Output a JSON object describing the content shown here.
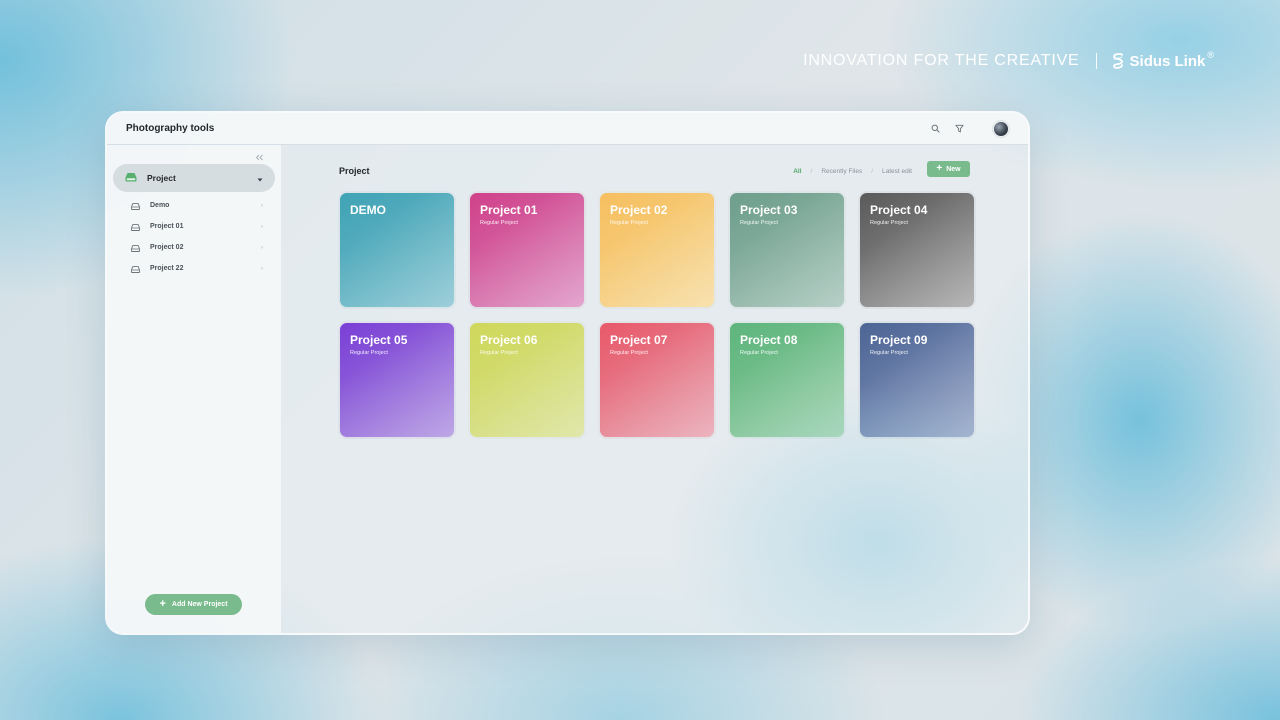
{
  "brand": {
    "tagline": "INNOVATION FOR THE CREATIVE",
    "name": "Sidus Link",
    "registered_mark": "®"
  },
  "window": {
    "title": "Photography tools",
    "icons": [
      "search-icon",
      "filter-icon",
      "avatar"
    ]
  },
  "sidebar": {
    "section_label": "Project",
    "items": [
      {
        "label": "Demo",
        "icon": "drive-icon"
      },
      {
        "label": "Project 01",
        "icon": "drive-icon"
      },
      {
        "label": "Project 02",
        "icon": "drive-icon"
      },
      {
        "label": "Project 22",
        "icon": "drive-icon"
      }
    ],
    "add_button": {
      "plus": "+",
      "label": "Add New Project"
    }
  },
  "main": {
    "title": "Project",
    "filters": {
      "all": "All",
      "recent": "Recently Files",
      "latest": "Latest edit",
      "separator": "/"
    },
    "new_button": {
      "plus": "+",
      "label": "New"
    }
  },
  "cards": [
    {
      "title": "DEMO",
      "subtitle": "",
      "color_from": "#3fa3b5",
      "color_to": "#77bccb"
    },
    {
      "title": "Project 01",
      "subtitle": "Regular Project",
      "color_from": "#d0418a",
      "color_to": "#d883bb"
    },
    {
      "title": "Project 02",
      "subtitle": "Regular Project",
      "color_from": "#f6bf5f",
      "color_to": "#f5d690"
    },
    {
      "title": "Project 03",
      "subtitle": "Regular Project",
      "color_from": "#6e9e8c",
      "color_to": "#9abdb0"
    },
    {
      "title": "Project 04",
      "subtitle": "Regular Project",
      "color_from": "#5a5a5a",
      "color_to": "#9a9a9a"
    },
    {
      "title": "Project 05",
      "subtitle": "Regular Project",
      "color_from": "#7a3fd6",
      "color_to": "#a585dc"
    },
    {
      "title": "Project 06",
      "subtitle": "Regular Project",
      "color_from": "#cfd85a",
      "color_to": "#d5de8a"
    },
    {
      "title": "Project 07",
      "subtitle": "Regular Project",
      "color_from": "#e8596a",
      "color_to": "#e497a6"
    },
    {
      "title": "Project 08",
      "subtitle": "Regular Project",
      "color_from": "#5db57c",
      "color_to": "#8fcaa0"
    },
    {
      "title": "Project 09",
      "subtitle": "Regular Project",
      "color_from": "#4d6595",
      "color_to": "#8597bd"
    }
  ]
}
